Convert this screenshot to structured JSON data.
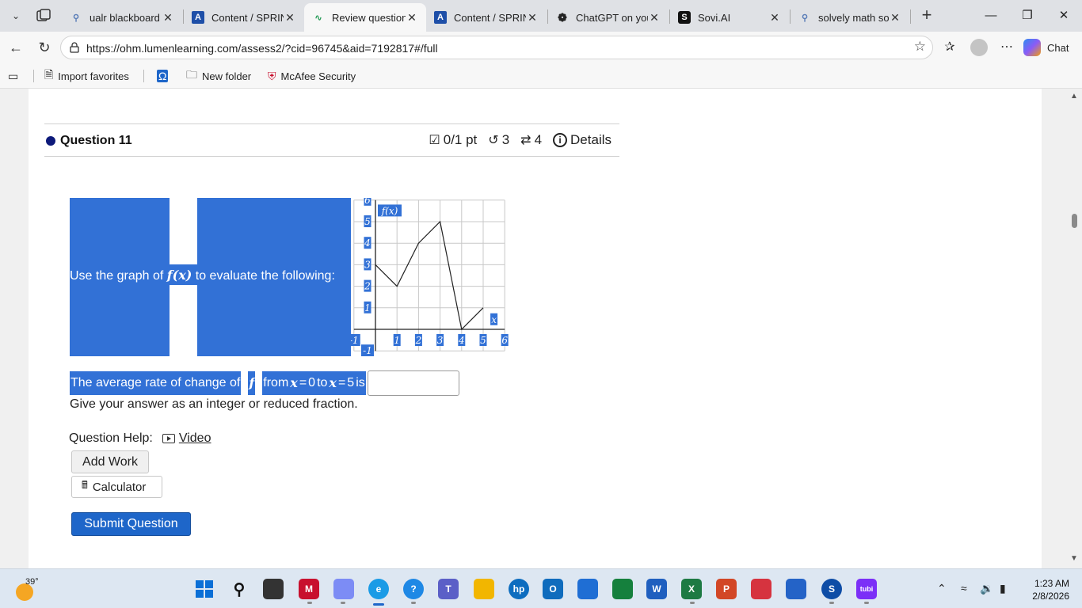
{
  "browser": {
    "tabs": [
      {
        "title": "ualr blackboard - S",
        "icon": "search-icon"
      },
      {
        "title": "Content / SPRING",
        "icon": "blackboard-icon"
      },
      {
        "title": "Review questions",
        "icon": "lumen-icon",
        "active": true
      },
      {
        "title": "Content / SPRING",
        "icon": "blackboard-icon"
      },
      {
        "title": "ChatGPT on your c",
        "icon": "chatgpt-icon"
      },
      {
        "title": "Sovi.AI",
        "icon": "sovi-icon"
      },
      {
        "title": "solvely math solve",
        "icon": "search-icon"
      }
    ],
    "url": "https://ohm.lumenlearning.com/assess2/?cid=96745&aid=7192817#/full",
    "chat_label": "Chat",
    "favorites": [
      {
        "label": "Import favorites",
        "icon": "import-icon"
      },
      {
        "label": "",
        "icon": "omega-icon"
      },
      {
        "label": "New folder",
        "icon": "folder-icon"
      },
      {
        "label": "McAfee Security",
        "icon": "mcafee-icon"
      }
    ]
  },
  "question": {
    "title": "Question 11",
    "score": "0/1 pt",
    "retries": "3",
    "attempts": "4",
    "details_label": "Details",
    "prompt_before": "Use the graph of",
    "prompt_fx": "f(x)",
    "prompt_after": "to evaluate the following:",
    "avg_parts": {
      "t1": "The average rate of change of",
      "f": "f",
      "t2": "from",
      "x1": "x",
      "eq1": "=",
      "a": "0",
      "t3": "to",
      "x2": "x",
      "eq2": "=",
      "b": "5",
      "t4": "is"
    },
    "answer_value": "",
    "hint": "Give your answer as an integer or reduced fraction.",
    "help_label": "Question Help:",
    "video_label": "Video",
    "add_work_label": "Add Work",
    "calculator_label": "Calculator",
    "submit_label": "Submit Question"
  },
  "graph": {
    "y_axis_label": "f(x)",
    "x_axis_label": "x",
    "x_ticks": [
      "-1",
      "1",
      "2",
      "3",
      "4",
      "5",
      "6"
    ],
    "y_ticks": [
      "-1",
      "1",
      "2",
      "3",
      "4",
      "5",
      "6"
    ],
    "points": [
      [
        0,
        3
      ],
      [
        1,
        2
      ],
      [
        2,
        4
      ],
      [
        3,
        5
      ],
      [
        4,
        0
      ],
      [
        5,
        1
      ]
    ]
  },
  "taskbar": {
    "temperature": "39°",
    "time": "1:23 AM",
    "date": "2/8/2026"
  }
}
